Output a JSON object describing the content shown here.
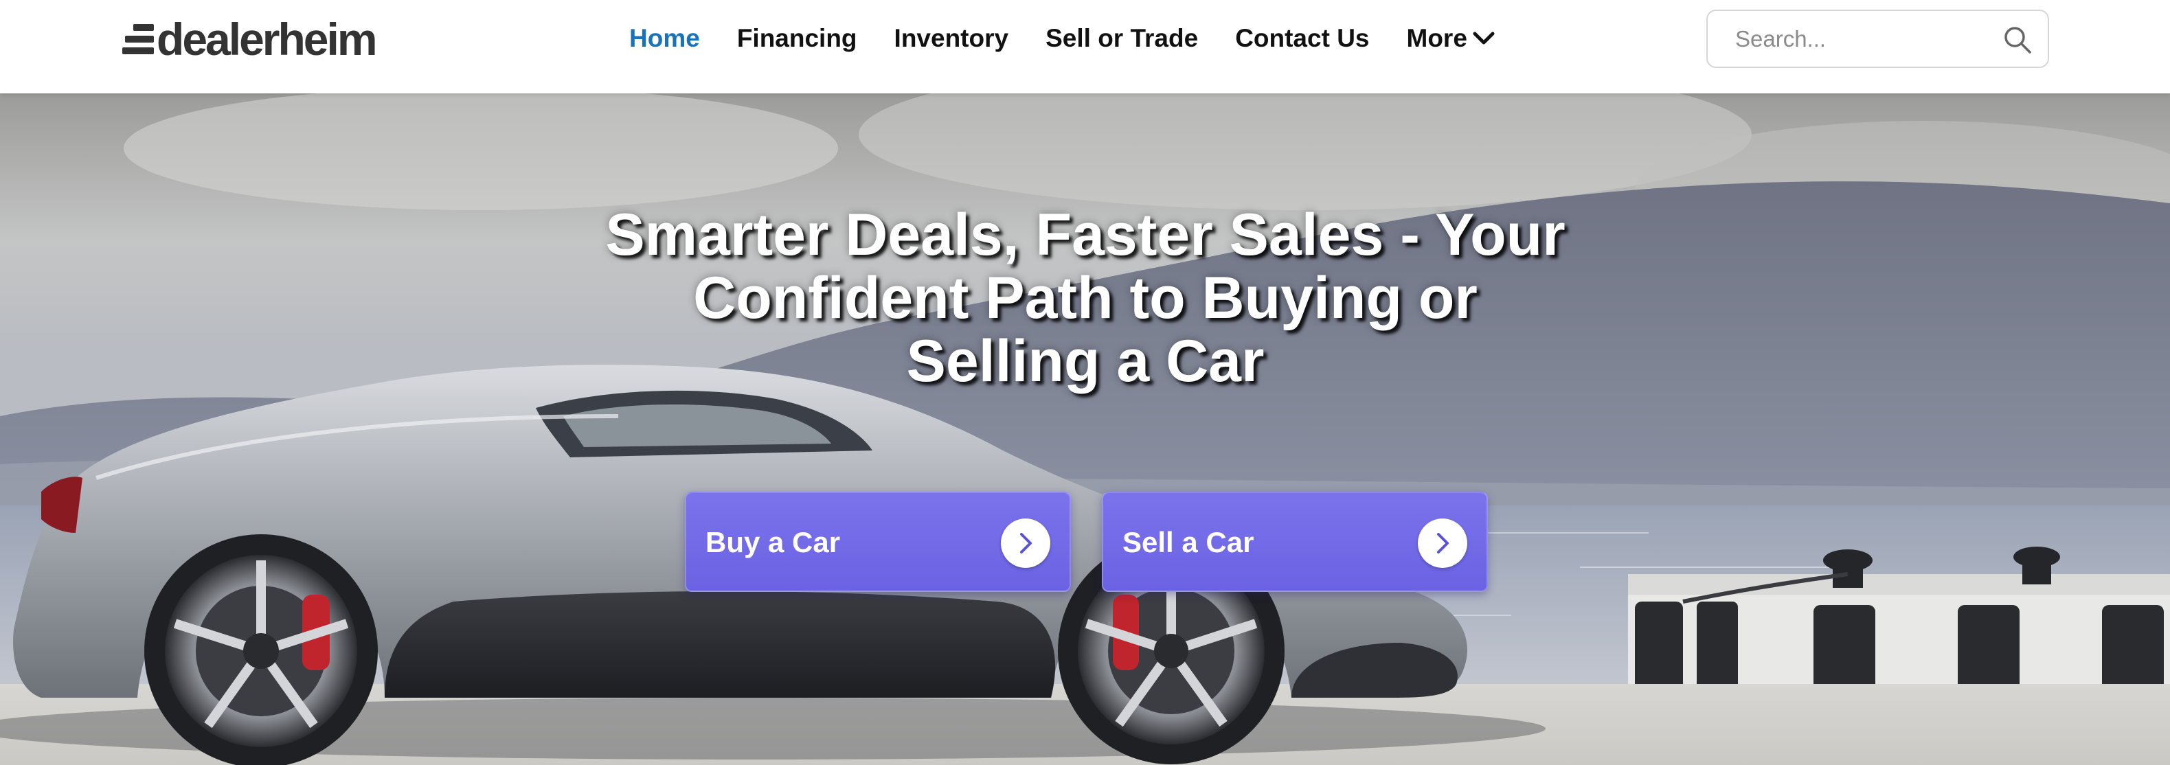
{
  "brand": {
    "name": "dealerheim",
    "text_color": "#333333"
  },
  "nav": {
    "items": [
      {
        "label": "Home",
        "active": true
      },
      {
        "label": "Financing",
        "active": false
      },
      {
        "label": "Inventory",
        "active": false
      },
      {
        "label": "Sell or Trade",
        "active": false
      },
      {
        "label": "Contact Us",
        "active": false
      },
      {
        "label": "More",
        "active": false,
        "icon": "chevron-down-icon"
      }
    ],
    "active_color": "#1a73b8"
  },
  "search": {
    "placeholder": "Search...",
    "value": "",
    "icon": "search-icon"
  },
  "hero": {
    "title": "Smarter Deals, Faster Sales - Your Confident Path to Buying or Selling a Car",
    "title_lines": [
      "Smarter Deals, Faster Sales - Your",
      "Confident Path to Buying or",
      "Selling a Car"
    ],
    "background_image": "silver sports car parked on a pier by the sea with hills behind",
    "buttons": [
      {
        "label": "Buy a Car",
        "icon": "chevron-right-icon"
      },
      {
        "label": "Sell a Car",
        "icon": "chevron-right-icon"
      }
    ],
    "button_color": "#7068e8"
  }
}
